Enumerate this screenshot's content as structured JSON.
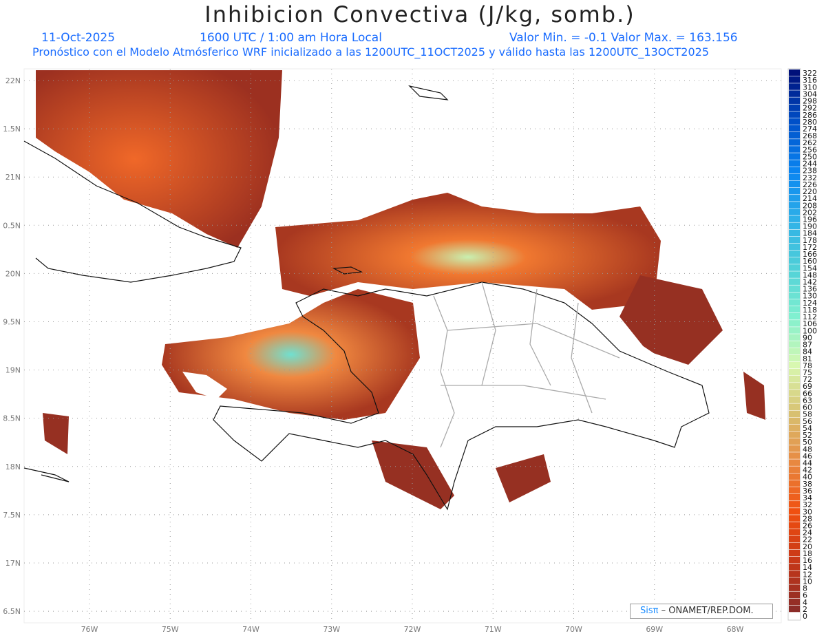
{
  "header": {
    "title": "Inhibicion Convectiva (J/kg, somb.)",
    "date": "11-Oct-2025",
    "time": "1600 UTC / 1:00 am Hora Local",
    "min_max": "Valor Min. = -0.1  Valor Max. = 163.156",
    "description": "Pronóstico con el Modelo Atmósferico WRF inicializado a las 1200UTC_11OCT2025 y válido hasta las  1200UTC_13OCT2025"
  },
  "axes": {
    "lat_labels": [
      "22N",
      "1.5N",
      "21N",
      "0.5N",
      "20N",
      "9.5N",
      "19N",
      "8.5N",
      "18N",
      "7.5N",
      "17N",
      "6.5N"
    ],
    "lon_labels": [
      "76W",
      "75W",
      "74W",
      "73W",
      "72W",
      "71W",
      "70W",
      "69W",
      "68W"
    ]
  },
  "colorbar": {
    "labels": [
      "322",
      "316",
      "310",
      "304",
      "298",
      "292",
      "286",
      "280",
      "274",
      "268",
      "262",
      "256",
      "250",
      "244",
      "238",
      "232",
      "226",
      "220",
      "214",
      "208",
      "202",
      "196",
      "190",
      "184",
      "178",
      "172",
      "166",
      "160",
      "154",
      "148",
      "142",
      "136",
      "130",
      "124",
      "118",
      "112",
      "106",
      "100",
      "90",
      "87",
      "84",
      "81",
      "78",
      "75",
      "72",
      "69",
      "66",
      "63",
      "60",
      "58",
      "56",
      "54",
      "52",
      "50",
      "48",
      "46",
      "44",
      "42",
      "40",
      "38",
      "36",
      "34",
      "32",
      "30",
      "28",
      "26",
      "24",
      "22",
      "20",
      "18",
      "16",
      "14",
      "12",
      "10",
      "8",
      "6",
      "4",
      "2",
      "0"
    ],
    "anchor_colors": [
      "#00107a",
      "#0050c8",
      "#0a84f0",
      "#2eb0e8",
      "#50d0d8",
      "#80f0d0",
      "#d8f8b0",
      "#d8c070",
      "#e88840",
      "#f05010",
      "#c83818",
      "#8c2c28",
      "#ffffff"
    ]
  },
  "credit": {
    "brand": "Sisπ",
    "text": "– ONAMET/REP.DOM."
  }
}
